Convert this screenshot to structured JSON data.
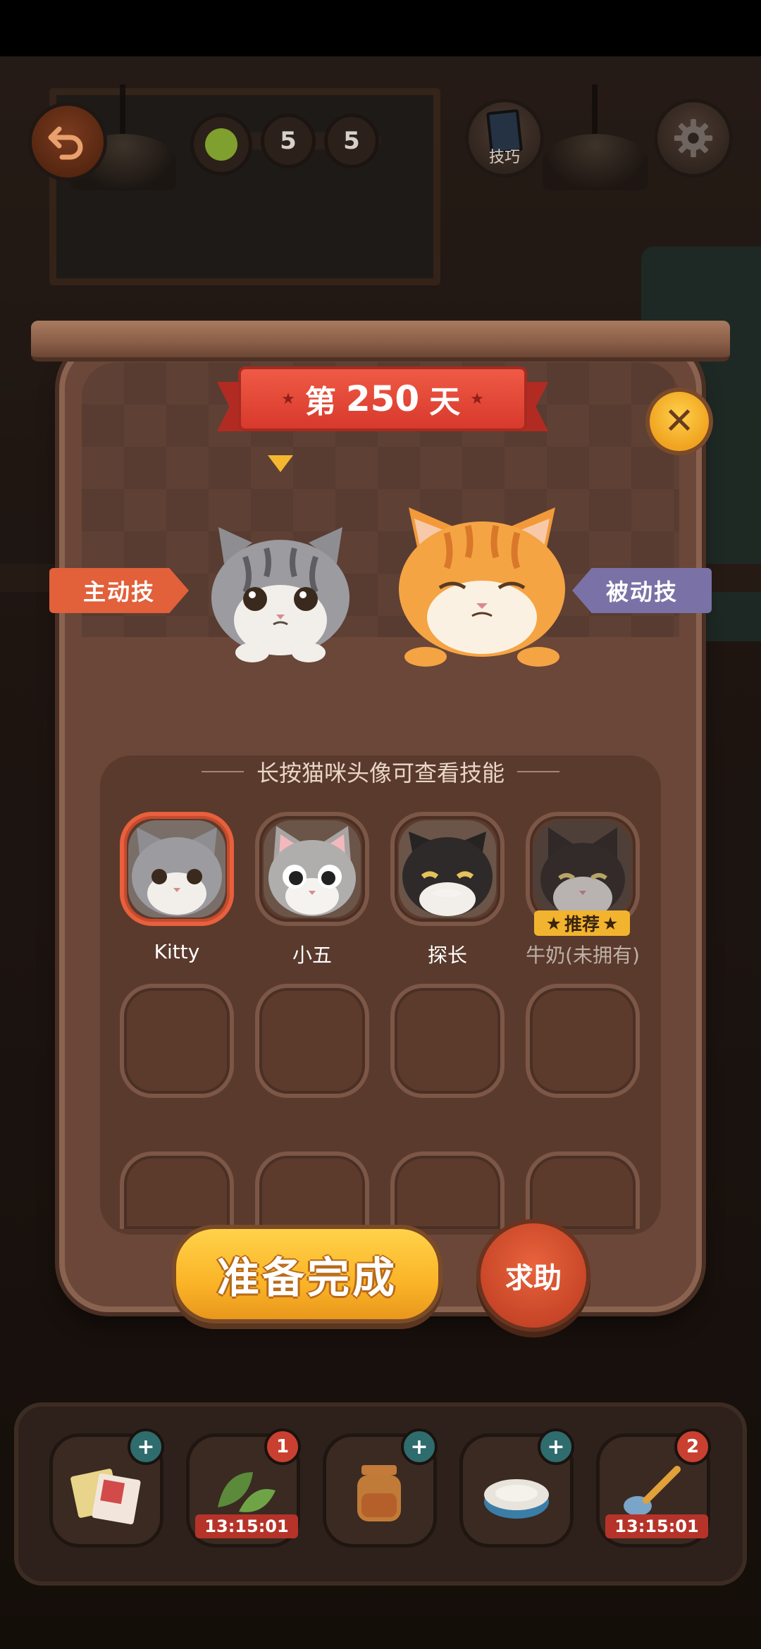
{
  "hud": {
    "level_nodes": [
      "5",
      "5"
    ],
    "skill_label": "技巧"
  },
  "dialog": {
    "title_prefix": "第",
    "day_number": "250",
    "title_suffix": "天",
    "active_skill_label": "主动技",
    "passive_skill_label": "被动技",
    "hint": "长按猫咪头像可查看技能",
    "cats": [
      {
        "name": "Kitty",
        "selected": true,
        "owned": true
      },
      {
        "name": "小五",
        "selected": false,
        "owned": true
      },
      {
        "name": "探长",
        "selected": false,
        "owned": true
      },
      {
        "name": "牛奶(未拥有)",
        "selected": false,
        "owned": false
      }
    ],
    "recommended_badge": "推荐",
    "ready_label": "准备完成",
    "help_label": "求助"
  },
  "inventory": {
    "items": [
      {
        "icon": "book-icon",
        "badge": "+"
      },
      {
        "icon": "leaf-icon",
        "badge": "1",
        "timer": "13:15:01"
      },
      {
        "icon": "jar-icon",
        "badge": "+"
      },
      {
        "icon": "food-bowl-icon",
        "badge": "+"
      },
      {
        "icon": "spoon-icon",
        "badge": "2",
        "timer": "13:15:01"
      }
    ]
  },
  "colors": {
    "accent_orange": "#e2603a",
    "passive_purple": "#7a72a6",
    "ribbon_red": "#d8392c",
    "ready_yellow": "#fbb427",
    "panel_brown": "#6a4738"
  }
}
